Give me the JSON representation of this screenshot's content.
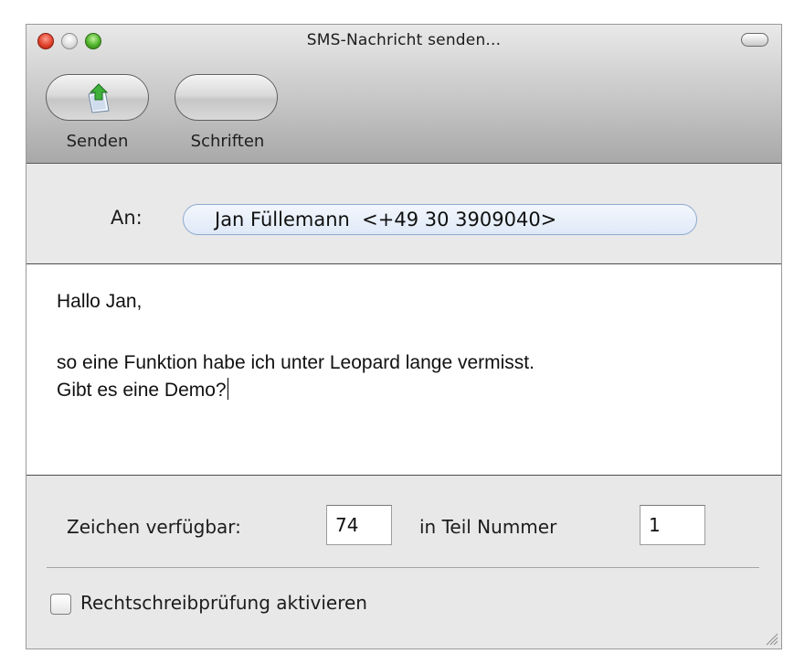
{
  "window": {
    "title": "SMS-Nachricht senden..."
  },
  "toolbar": {
    "send_label": "Senden",
    "send_icon": "send-sms-icon",
    "fonts_label": "Schriften"
  },
  "recipient": {
    "label": "An:",
    "value": "Jan Füllemann  <+49 30 3909040>"
  },
  "message": {
    "greeting": "Hallo Jan,",
    "line1": "so eine Funktion habe ich unter Leopard lange vermisst.",
    "line2": "Gibt es eine Demo?"
  },
  "footer": {
    "chars_label": "Zeichen verfügbar:",
    "chars_value": "74",
    "part_label": "in Teil Nummer",
    "part_value": "1",
    "spellcheck_label": "Rechtschreibprüfung aktivieren",
    "spellcheck_checked": false
  },
  "colors": {
    "close": "#e0432c",
    "zoom": "#4fb22a",
    "token_border": "#8fa9cf"
  }
}
